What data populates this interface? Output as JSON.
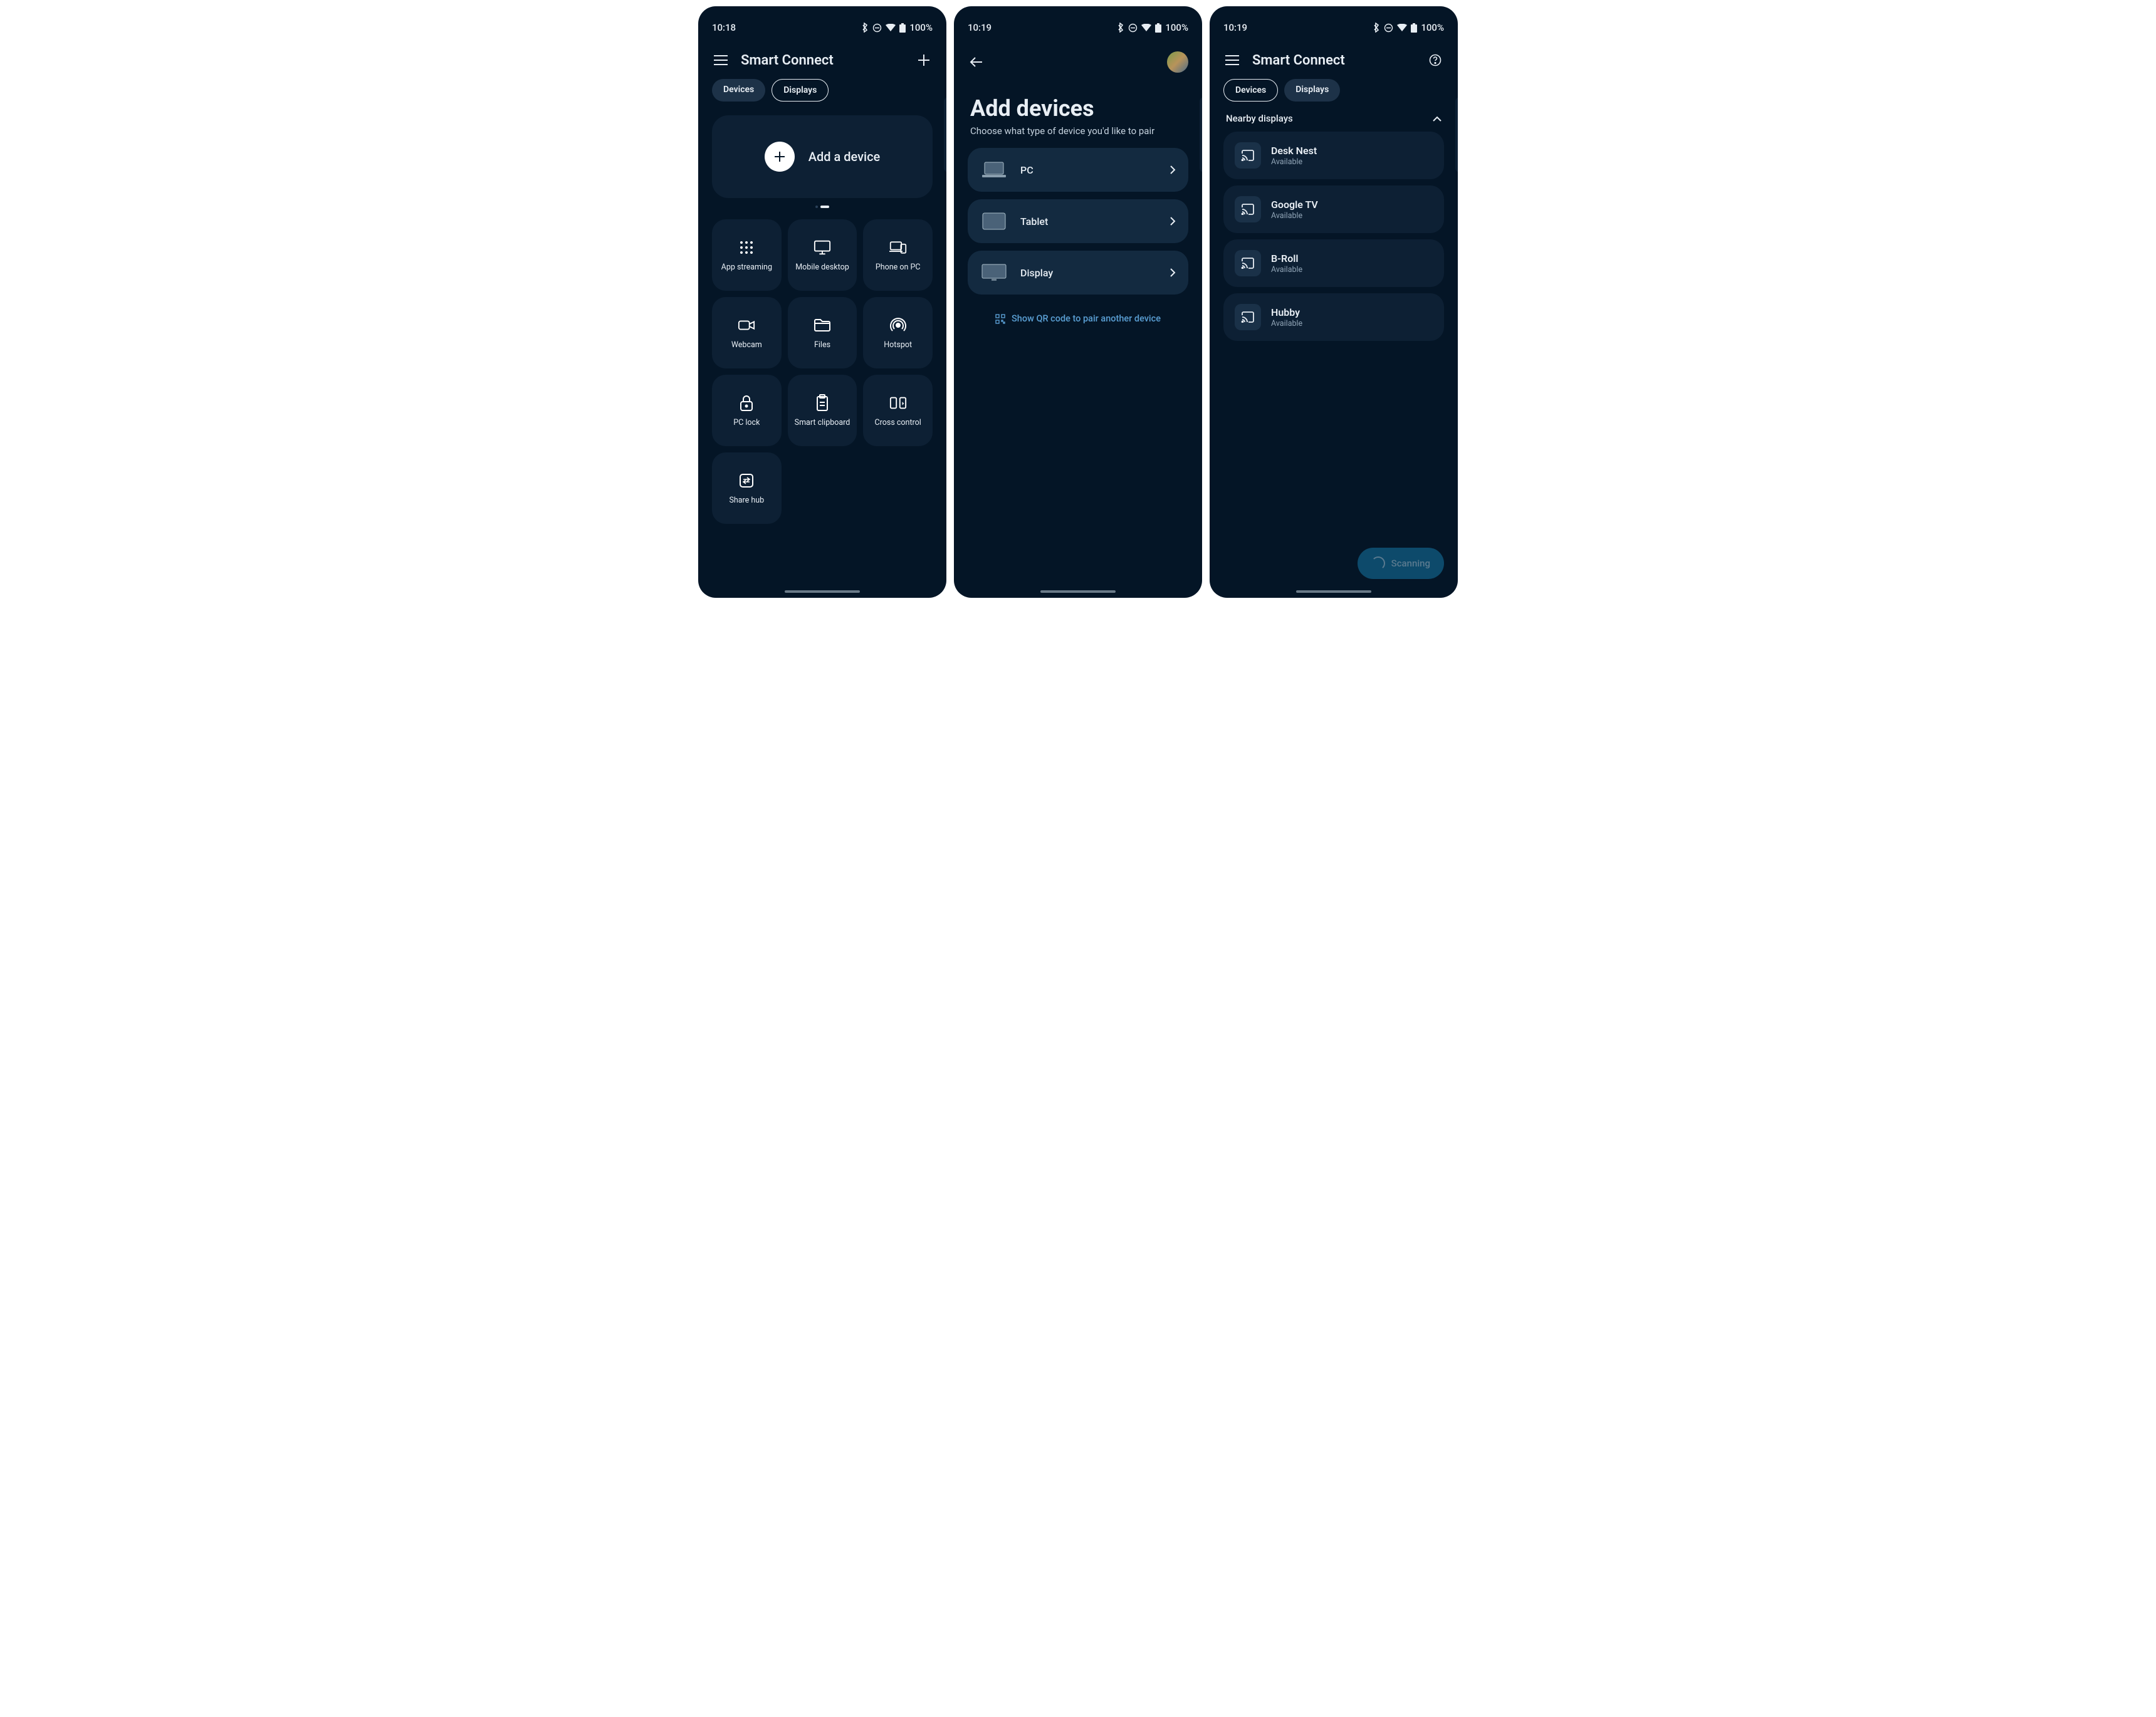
{
  "statusbar": {
    "time_s1": "10:18",
    "time_s2": "10:19",
    "time_s3": "10:19",
    "battery": "100%"
  },
  "app_title": "Smart Connect",
  "tabs": {
    "devices": "Devices",
    "displays": "Displays"
  },
  "screen1": {
    "hero_label": "Add a device",
    "tiles": [
      {
        "label": "App streaming",
        "icon": "grid-icon"
      },
      {
        "label": "Mobile desktop",
        "icon": "monitor-icon"
      },
      {
        "label": "Phone on PC",
        "icon": "phone-pc-icon"
      },
      {
        "label": "Webcam",
        "icon": "webcam-icon"
      },
      {
        "label": "Files",
        "icon": "folder-icon"
      },
      {
        "label": "Hotspot",
        "icon": "hotspot-icon"
      },
      {
        "label": "PC lock",
        "icon": "lock-icon"
      },
      {
        "label": "Smart clipboard",
        "icon": "clipboard-icon"
      },
      {
        "label": "Cross control",
        "icon": "cross-control-icon"
      },
      {
        "label": "Share hub",
        "icon": "share-hub-icon"
      }
    ]
  },
  "screen2": {
    "title": "Add devices",
    "subtitle": "Choose what type of device you'd like to pair",
    "options": [
      {
        "label": "PC",
        "icon": "laptop-visual"
      },
      {
        "label": "Tablet",
        "icon": "tablet-visual"
      },
      {
        "label": "Display",
        "icon": "display-visual"
      }
    ],
    "qr_label": "Show QR code to pair another device"
  },
  "screen3": {
    "section_title": "Nearby displays",
    "displays": [
      {
        "name": "Desk Nest",
        "status": "Available"
      },
      {
        "name": "Google TV",
        "status": "Available"
      },
      {
        "name": "B-Roll",
        "status": "Available"
      },
      {
        "name": "Hubby",
        "status": "Available"
      }
    ],
    "scanning_label": "Scanning"
  }
}
